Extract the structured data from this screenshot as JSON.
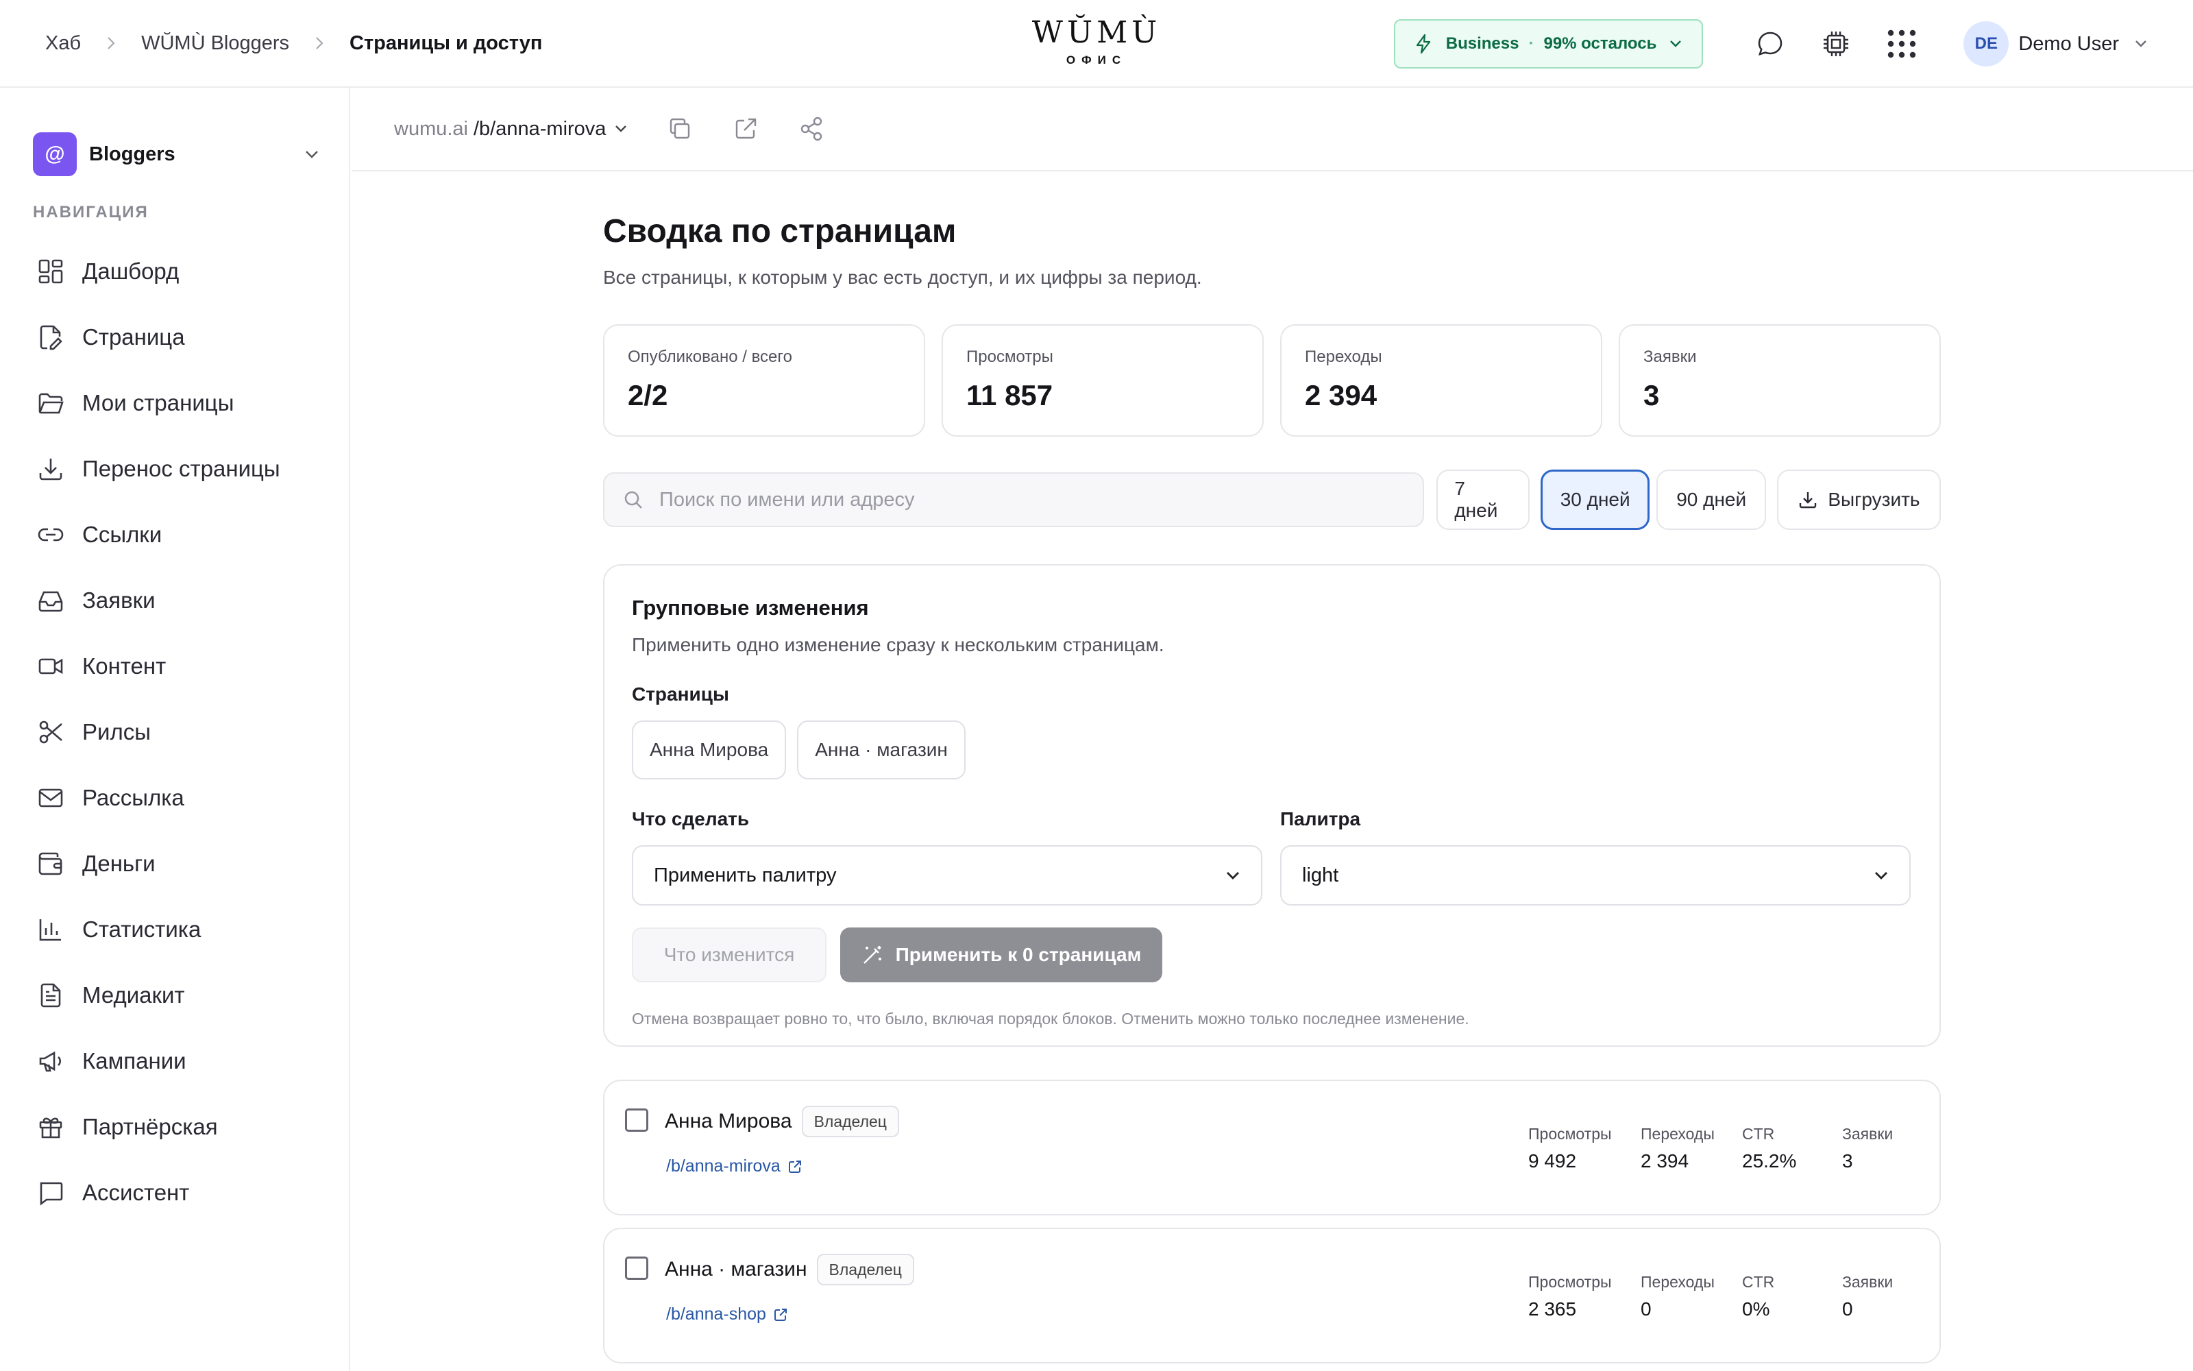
{
  "header": {
    "breadcrumbs": [
      "Хаб",
      "WŬMÙ Bloggers",
      "Страницы и доступ"
    ],
    "logo": "WŬMÙ",
    "logo_sub": "ОФИС",
    "plan": {
      "name": "Business",
      "sep": "·",
      "remaining": "99% осталось"
    },
    "user": {
      "initials": "DE",
      "name": "Demo User"
    }
  },
  "sidebar": {
    "workspace_icon": "@",
    "workspace": "Bloggers",
    "nav_title": "НАВИГАЦИЯ",
    "items": [
      {
        "label": "Дашборд",
        "icon": "dashboard-icon"
      },
      {
        "label": "Страница",
        "icon": "page-edit-icon"
      },
      {
        "label": "Мои страницы",
        "icon": "folder-icon"
      },
      {
        "label": "Перенос страницы",
        "icon": "download-icon"
      },
      {
        "label": "Ссылки",
        "icon": "link-icon"
      },
      {
        "label": "Заявки",
        "icon": "inbox-icon"
      },
      {
        "label": "Контент",
        "icon": "video-icon"
      },
      {
        "label": "Рилсы",
        "icon": "scissors-icon"
      },
      {
        "label": "Рассылка",
        "icon": "mail-icon"
      },
      {
        "label": "Деньги",
        "icon": "wallet-icon"
      },
      {
        "label": "Статистика",
        "icon": "bar-chart-icon"
      },
      {
        "label": "Медиакит",
        "icon": "document-icon"
      },
      {
        "label": "Кампании",
        "icon": "megaphone-icon"
      },
      {
        "label": "Партнёрская",
        "icon": "gift-icon"
      },
      {
        "label": "Ассистент",
        "icon": "chat-icon"
      }
    ]
  },
  "urlbar": {
    "host": "wumu.ai",
    "path": "/b/anna-mirova"
  },
  "main": {
    "title": "Сводка по страницам",
    "subtitle": "Все страницы, к которым у вас есть доступ, и их цифры за период.",
    "stats": [
      {
        "label": "Опубликовано / всего",
        "value": "2/2"
      },
      {
        "label": "Просмотры",
        "value": "11 857"
      },
      {
        "label": "Переходы",
        "value": "2 394"
      },
      {
        "label": "Заявки",
        "value": "3"
      }
    ],
    "search_placeholder": "Поиск по имени или адресу",
    "periods": [
      "7 дней",
      "30 дней",
      "90 дней"
    ],
    "active_period": "30 дней",
    "export_label": "Выгрузить",
    "bulk": {
      "title": "Групповые изменения",
      "description": "Применить одно изменение сразу к нескольким страницам.",
      "pages_label": "Страницы",
      "pages": [
        "Анна Мирова",
        "Анна · магазин"
      ],
      "action_label": "Что сделать",
      "action_value": "Применить палитру",
      "palette_label": "Палитра",
      "palette_value": "light",
      "preview_label": "Что изменится",
      "apply_label": "Применить к 0 страницам",
      "note": "Отмена возвращает ровно то, что было, включая порядок блоков. Отменить можно только последнее изменение."
    },
    "rows": [
      {
        "name": "Анна Мирова",
        "role": "Владелец",
        "path": "/b/anna-mirova",
        "metrics": [
          {
            "label": "Просмотры",
            "value": "9 492"
          },
          {
            "label": "Переходы",
            "value": "2 394"
          },
          {
            "label": "CTR",
            "value": "25.2%"
          },
          {
            "label": "Заявки",
            "value": "3"
          }
        ]
      },
      {
        "name": "Анна · магазин",
        "role": "Владелец",
        "path": "/b/anna-shop",
        "metrics": [
          {
            "label": "Просмотры",
            "value": "2 365"
          },
          {
            "label": "Переходы",
            "value": "0"
          },
          {
            "label": "CTR",
            "value": "0%"
          },
          {
            "label": "Заявки",
            "value": "0"
          }
        ]
      }
    ]
  }
}
